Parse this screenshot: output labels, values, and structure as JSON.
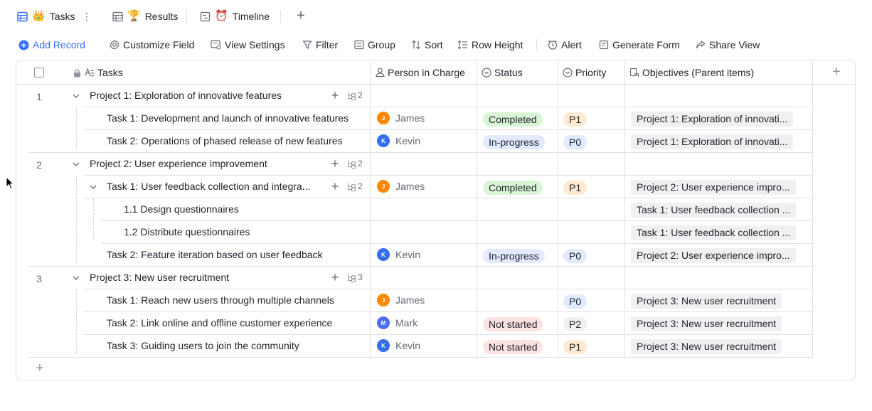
{
  "tabs": [
    {
      "label": "Tasks",
      "emoji": "👑",
      "icon": "grid-view-icon"
    },
    {
      "label": "Results",
      "emoji": "🏆",
      "icon": "grid-view-icon"
    },
    {
      "label": "Timeline",
      "emoji": "⏰",
      "icon": "timeline-view-icon"
    }
  ],
  "toolbar": {
    "add_record": "Add Record",
    "customize_field": "Customize Field",
    "view_settings": "View Settings",
    "filter": "Filter",
    "group": "Group",
    "sort": "Sort",
    "row_height": "Row Height",
    "alert": "Alert",
    "generate_form": "Generate Form",
    "share_view": "Share View"
  },
  "columns": {
    "tasks": "Tasks",
    "person": "Person in Charge",
    "status": "Status",
    "priority": "Priority",
    "objectives": "Objectives (Parent items)"
  },
  "colors": {
    "accent": "#3370ff",
    "completed_bg": "#d9f5d6",
    "completed_fg": "#1f2329",
    "inprogress_bg": "#e1eaff",
    "inprogress_fg": "#1f2329",
    "notstarted_bg": "#fde2e2",
    "notstarted_fg": "#1f2329",
    "p0_bg": "#e1eaff",
    "p1_bg": "#feead2",
    "p2_bg": "#eff0f1",
    "james": "#ff8800",
    "kevin": "#336df4",
    "mark": "#4c6ef5"
  },
  "rows": [
    {
      "num": "1",
      "level": 0,
      "title": "Project 1: Exploration of innovative features",
      "subcount": "2"
    },
    {
      "level": 1,
      "title": "Task 1: Development and launch of innovative features",
      "person": "James",
      "initial": "J",
      "status": "Completed",
      "priority": "P1",
      "objective": "Project 1: Exploration of innovati..."
    },
    {
      "level": 1,
      "title": "Task 2: Operations of phased release of new features",
      "person": "Kevin",
      "initial": "K",
      "status": "In-progress",
      "priority": "P0",
      "objective": "Project 1: Exploration of innovati..."
    },
    {
      "num": "2",
      "level": 0,
      "title": "Project 2: User experience improvement",
      "subcount": "2"
    },
    {
      "level": 1,
      "title": "Task 1: User feedback collection and integra...",
      "subcount": "2",
      "person": "James",
      "initial": "J",
      "status": "Completed",
      "priority": "P1",
      "objective": "Project 2: User experience impro..."
    },
    {
      "level": 2,
      "title": "1.1 Design questionnaires",
      "objective": "Task 1: User feedback collection ..."
    },
    {
      "level": 2,
      "title": "1.2 Distribute questionnaires",
      "objective": "Task 1: User feedback collection ..."
    },
    {
      "level": 1,
      "title": "Task 2: Feature iteration based on user feedback",
      "person": "Kevin",
      "initial": "K",
      "status": "In-progress",
      "priority": "P0",
      "objective": "Project 2: User experience impro..."
    },
    {
      "num": "3",
      "level": 0,
      "title": "Project 3: New user recruitment",
      "subcount": "3"
    },
    {
      "level": 1,
      "title": "Task 1: Reach new users through multiple channels",
      "person": "James",
      "initial": "J",
      "priority": "P0",
      "objective": "Project 3: New user recruitment"
    },
    {
      "level": 1,
      "title": "Task 2: Link online and offline customer experience",
      "person": "Mark",
      "initial": "M",
      "status": "Not started",
      "priority": "P2",
      "objective": "Project 3: New user recruitment"
    },
    {
      "level": 1,
      "title": "Task 3: Guiding users to join the community",
      "person": "Kevin",
      "initial": "K",
      "status": "Not started",
      "priority": "P1",
      "objective": "Project 3: New user recruitment"
    }
  ]
}
